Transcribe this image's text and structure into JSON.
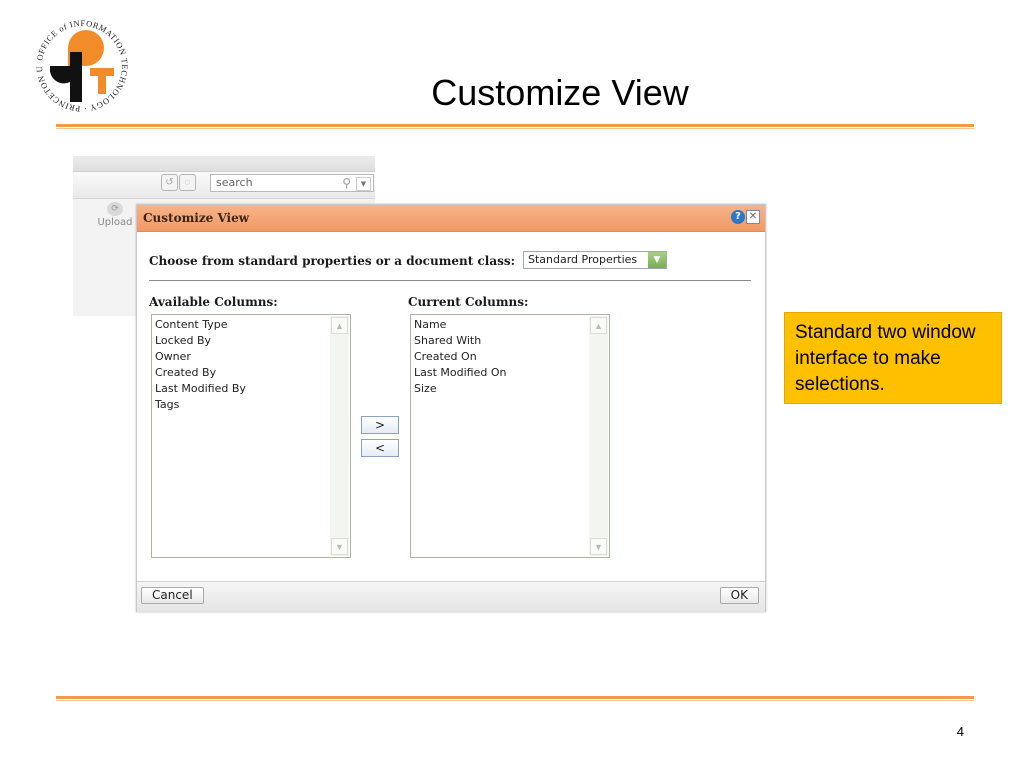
{
  "slide": {
    "title": "Customize View",
    "page_number": "4",
    "callout": "Standard two window interface to make selections.",
    "logo_text": "OFFICE of INFORMATION TECHNOLOGY · PRINCETON UNIVERSITY ·"
  },
  "app": {
    "search_placeholder": "search",
    "upload_label": "Upload"
  },
  "dialog": {
    "title": "Customize View",
    "choose_label": "Choose from standard properties or a document class:",
    "selected_class": "Standard Properties",
    "available_header": "Available Columns:",
    "current_header": "Current Columns:",
    "available_columns": [
      "Content Type",
      "Locked By",
      "Owner",
      "Created By",
      "Last Modified By",
      "Tags"
    ],
    "current_columns": [
      "Name",
      "Shared With",
      "Created On",
      "Last Modified On",
      "Size"
    ],
    "add_button": ">",
    "remove_button": "<",
    "cancel_button": "Cancel",
    "ok_button": "OK"
  },
  "colors": {
    "accent_orange": "#f29a45",
    "dialog_title_bg": "#f19a66",
    "callout_bg": "#ffc000"
  }
}
